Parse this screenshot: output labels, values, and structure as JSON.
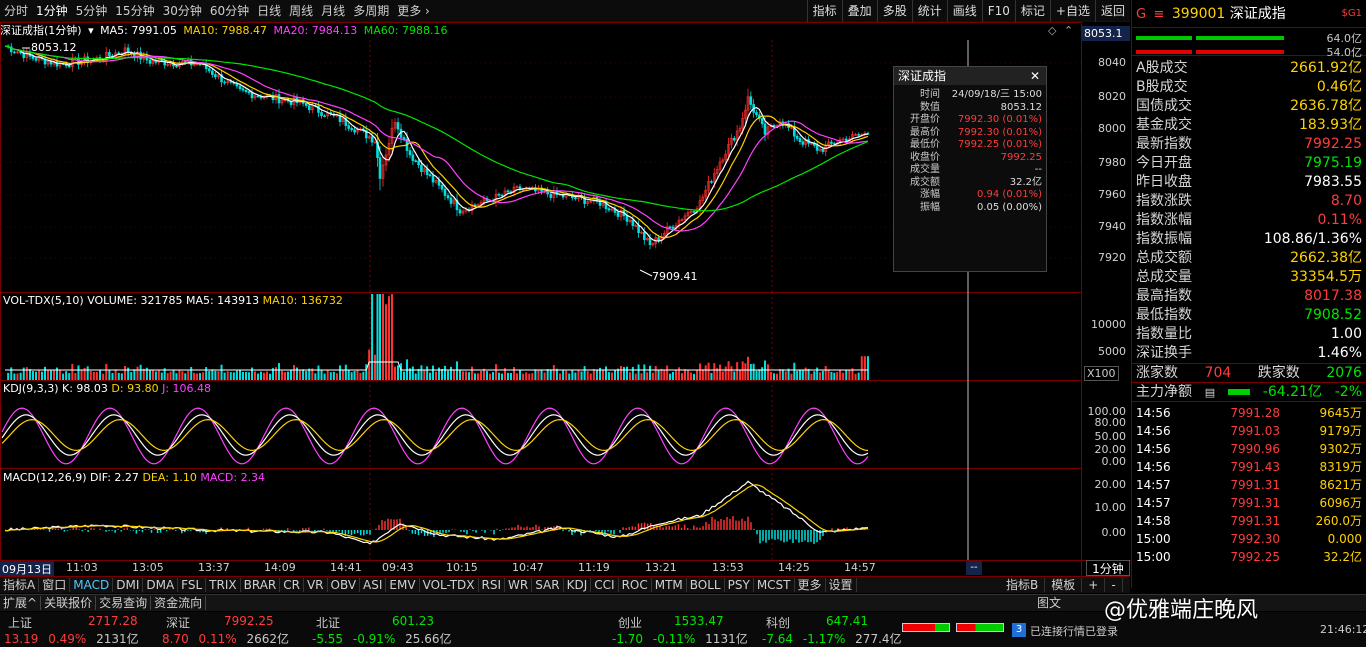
{
  "toolbar": {
    "periods": [
      "分时",
      "1分钟",
      "5分钟",
      "15分钟",
      "30分钟",
      "60分钟",
      "日线",
      "周线",
      "月线",
      "多周期",
      "更多"
    ],
    "active": "1分钟",
    "tools": [
      "指标",
      "叠加",
      "多股",
      "统计",
      "画线",
      "F10",
      "标记",
      "+自选",
      "返回"
    ]
  },
  "main": {
    "title": "深证成指(1分钟)",
    "ma5": "MA5: 7991.05",
    "ma10": "MA10: 7988.47",
    "ma20": "MA20: 7984.13",
    "ma60": "MA60: 7988.16",
    "price_tag": "8053.1",
    "high_label": "8053.12",
    "low_label": "7909.41",
    "y_ticks": [
      "8040",
      "8020",
      "8000",
      "7980",
      "7960",
      "7940",
      "7920"
    ]
  },
  "tooltip": {
    "title": "深证成指",
    "rows": [
      {
        "k": "时间",
        "v": "24/09/18/三 15:00"
      },
      {
        "k": "数值",
        "v": "8053.12"
      },
      {
        "k": "开盘价",
        "v": "7992.30 (0.01%)"
      },
      {
        "k": "最高价",
        "v": "7992.30 (0.01%)"
      },
      {
        "k": "最低价",
        "v": "7992.25 (0.01%)"
      },
      {
        "k": "收盘价",
        "v": "7992.25"
      },
      {
        "k": "成交量",
        "v": "--"
      },
      {
        "k": "成交额",
        "v": "32.2亿"
      },
      {
        "k": "涨幅",
        "v": "0.94 (0.01%)"
      },
      {
        "k": "振幅",
        "v": "0.05 (0.00%)"
      }
    ]
  },
  "vol": {
    "title": "VOL-TDX(5,10)",
    "volume": "VOLUME: 321785",
    "ma5": "MA5: 143913",
    "ma10": "MA10: 136732",
    "y_ticks": [
      "10000",
      "5000"
    ],
    "unit": "X100"
  },
  "kdj": {
    "title": "KDJ(9,3,3)",
    "k": "K: 98.03",
    "d": "D: 93.80",
    "j": "J: 106.48",
    "y_ticks": [
      "100.00",
      "80.00",
      "50.00",
      "20.00",
      "0.00"
    ]
  },
  "macd": {
    "title": "MACD(12,26,9)",
    "dif": "DIF: 2.27",
    "dea": "DEA: 1.10",
    "macd": "MACD: 2.34",
    "y_ticks": [
      "20.00",
      "10.00",
      "0.00"
    ]
  },
  "time_axis": [
    "09月13日",
    "11:03",
    "13:05",
    "13:37",
    "14:09",
    "14:41",
    "09:43",
    "10:15",
    "10:47",
    "11:19",
    "13:21",
    "13:53",
    "14:25",
    "14:57"
  ],
  "time_axis_right": "1分钟",
  "bottom_tabs": [
    "指标A",
    "窗口",
    "MACD",
    "DMI",
    "DMA",
    "FSL",
    "TRIX",
    "BRAR",
    "CR",
    "VR",
    "OBV",
    "ASI",
    "EMV",
    "VOL-TDX",
    "RSI",
    "WR",
    "SAR",
    "KDJ",
    "CCI",
    "ROC",
    "MTM",
    "BOLL",
    "PSY",
    "MCST",
    "更多",
    "设置"
  ],
  "bottom_tabs_active": "MACD",
  "bottom_right": [
    "指标B",
    "模板",
    "+",
    "-"
  ],
  "ext_tabs": [
    "扩展^",
    "关联报价",
    "交易查询",
    "资金流向"
  ],
  "right": {
    "header_code": "399001",
    "header_name": "深证成指",
    "header_tag": "$G1",
    "bar1_value": "64.0亿",
    "bar2_value": "54.0亿",
    "stats": [
      {
        "k": "A股成交",
        "v": "2661.92亿",
        "c": "yellow"
      },
      {
        "k": "B股成交",
        "v": "0.46亿",
        "c": "yellow"
      },
      {
        "k": "国债成交",
        "v": "2636.78亿",
        "c": "yellow"
      },
      {
        "k": "基金成交",
        "v": "183.93亿",
        "c": "yellow"
      },
      {
        "k": "最新指数",
        "v": "7992.25",
        "c": "red"
      },
      {
        "k": "今日开盘",
        "v": "7975.19",
        "c": "green"
      },
      {
        "k": "昨日收盘",
        "v": "7983.55",
        "c": "white"
      },
      {
        "k": "指数涨跌",
        "v": "8.70",
        "c": "red"
      },
      {
        "k": "指数涨幅",
        "v": "0.11%",
        "c": "red"
      },
      {
        "k": "指数振幅",
        "v": "108.86/1.36%",
        "c": "white"
      },
      {
        "k": "总成交额",
        "v": "2662.38亿",
        "c": "yellow"
      },
      {
        "k": "总成交量",
        "v": "33354.5万",
        "c": "yellow"
      },
      {
        "k": "最高指数",
        "v": "8017.38",
        "c": "red"
      },
      {
        "k": "最低指数",
        "v": "7908.52",
        "c": "green"
      },
      {
        "k": "指数量比",
        "v": "1.00",
        "c": "white"
      },
      {
        "k": "深证换手",
        "v": "1.46%",
        "c": "white"
      }
    ],
    "up_label": "涨家数",
    "up_count": "704",
    "down_label": "跌家数",
    "down_count": "2076",
    "net_label": "主力净额",
    "net_value": "-64.21亿",
    "net_pct": "-2%",
    "ticks": [
      {
        "t": "14:56",
        "p": "7991.28",
        "v": "9645万"
      },
      {
        "t": "14:56",
        "p": "7991.03",
        "v": "9179万"
      },
      {
        "t": "14:56",
        "p": "7990.96",
        "v": "9302万"
      },
      {
        "t": "14:56",
        "p": "7991.43",
        "v": "8319万"
      },
      {
        "t": "14:57",
        "p": "7991.31",
        "v": "8621万"
      },
      {
        "t": "14:57",
        "p": "7991.31",
        "v": "6096万"
      },
      {
        "t": "14:58",
        "p": "7991.31",
        "v": "260.0万"
      },
      {
        "t": "15:00",
        "p": "7992.30",
        "v": "0.000"
      },
      {
        "t": "15:00",
        "p": "7992.25",
        "v": "32.2亿"
      }
    ]
  },
  "status": {
    "sh_name": "上证",
    "sh_val": "2717.28",
    "sh_chg": "13.19",
    "sh_pct": "0.49%",
    "sh_amt": "2131亿",
    "sz_name": "深证",
    "sz_val": "7992.25",
    "sz_chg": "8.70",
    "sz_pct": "0.11%",
    "sz_amt": "2662亿",
    "bz_name": "北证",
    "bz_val": "601.23",
    "bz_chg": "-5.55",
    "bz_pct": "-0.91%",
    "bz_amt": "25.66亿",
    "cy_name": "创业",
    "cy_val": "1533.47",
    "cy_chg": "-1.70",
    "cy_pct": "-0.11%",
    "cy_amt": "1131亿",
    "kc_name": "科创",
    "kc_val": "647.41",
    "kc_chg": "-7.64",
    "kc_pct": "-1.17%",
    "kc_amt": "277.4亿",
    "conn_badge": "3",
    "conn_text": "已连接行情已登录",
    "watermark": "@优雅端庄晚风",
    "tab_partial": "图文",
    "time": "21:46:12"
  }
}
